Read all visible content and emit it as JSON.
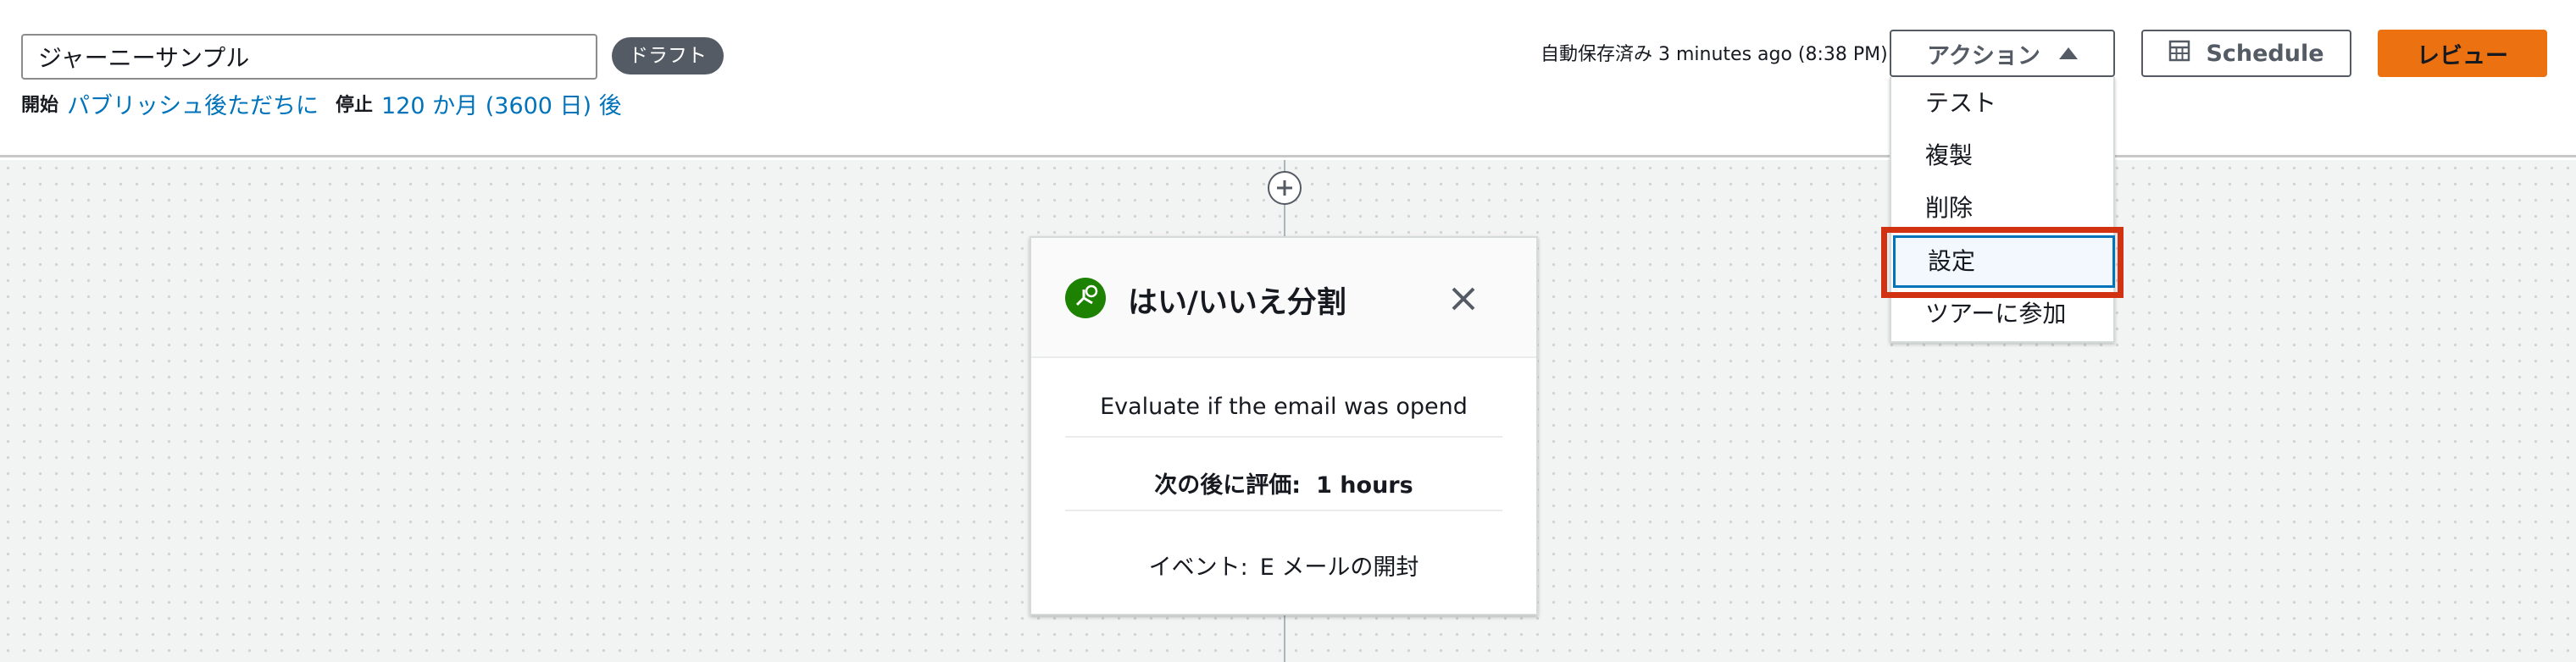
{
  "journey": {
    "name": "ジャーニーサンプル",
    "status_badge": "ドラフト",
    "start_label": "開始",
    "start_value": "パブリッシュ後ただちに",
    "stop_label": "停止",
    "stop_value": "120 か月 (3600 日) 後"
  },
  "header": {
    "autosave": "自動保存済み 3 minutes ago (8:38 PM)",
    "actions_label": "アクション",
    "schedule_label": "Schedule",
    "review_label": "レビュー"
  },
  "actions_menu": {
    "items": [
      "テスト",
      "複製",
      "削除",
      "設定",
      "ツアーに参加"
    ],
    "selected": "設定"
  },
  "card": {
    "title": "はい/いいえ分割",
    "description": "Evaluate if the email was opend",
    "eval_label": "次の後に評価:",
    "eval_value": "1 hours",
    "event_label": "イベント:",
    "event_value": "E メールの開封"
  },
  "colors": {
    "accent": "#ec7211",
    "link": "#0073bb",
    "highlight": "#d13212",
    "split_icon": "#1d8102"
  },
  "icons": [
    "chevron-up-icon",
    "calendar-icon",
    "plus-icon",
    "split-icon",
    "close-icon"
  ]
}
